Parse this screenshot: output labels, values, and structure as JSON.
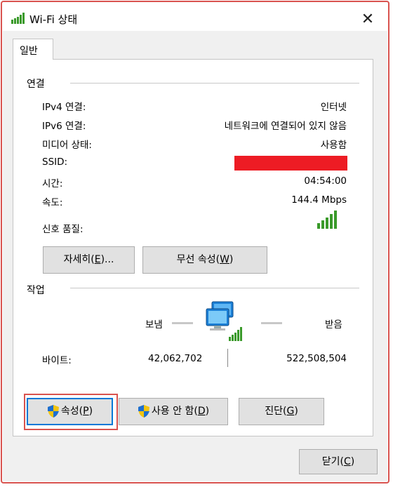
{
  "window": {
    "title": "Wi-Fi 상태",
    "close_glyph": "✕"
  },
  "tab": {
    "label": "일반"
  },
  "connection": {
    "group_label": "연결",
    "rows": [
      {
        "label": "IPv4 연결:",
        "value": "인터넷"
      },
      {
        "label": "IPv6 연결:",
        "value": "네트워크에 연결되어 있지 않음"
      },
      {
        "label": "미디어 상태:",
        "value": "사용함"
      },
      {
        "label": "SSID:",
        "value": ""
      },
      {
        "label": "시간:",
        "value": "04:54:00"
      },
      {
        "label": "속도:",
        "value": "144.4 Mbps"
      }
    ],
    "signal_label": "신호 품질:",
    "signal_bars_active": 5,
    "signal_bars_total": 5,
    "details_button": {
      "pre": "자세히(",
      "key": "E",
      "post": ")..."
    },
    "wireless_button": {
      "pre": "무선 속성(",
      "key": "W",
      "post": ")"
    }
  },
  "activity": {
    "group_label": "작업",
    "sent_label": "보냄",
    "received_label": "받음",
    "bytes_label": "바이트:",
    "bytes_sent": "42,062,702",
    "bytes_received": "522,508,504",
    "properties_button": {
      "pre": "속성(",
      "key": "P",
      "post": ")"
    },
    "disable_button": {
      "pre": "사용 안 함(",
      "key": "D",
      "post": ")"
    },
    "diagnose_button": {
      "pre": "진단(",
      "key": "G",
      "post": ")"
    }
  },
  "footer": {
    "close_button": {
      "pre": "닫기(",
      "key": "C",
      "post": ")"
    }
  },
  "colors": {
    "signal_green": "#3a9a2a",
    "redaction": "#ed1c24",
    "highlight": "#d9534f",
    "accent_border": "#0078d7"
  }
}
